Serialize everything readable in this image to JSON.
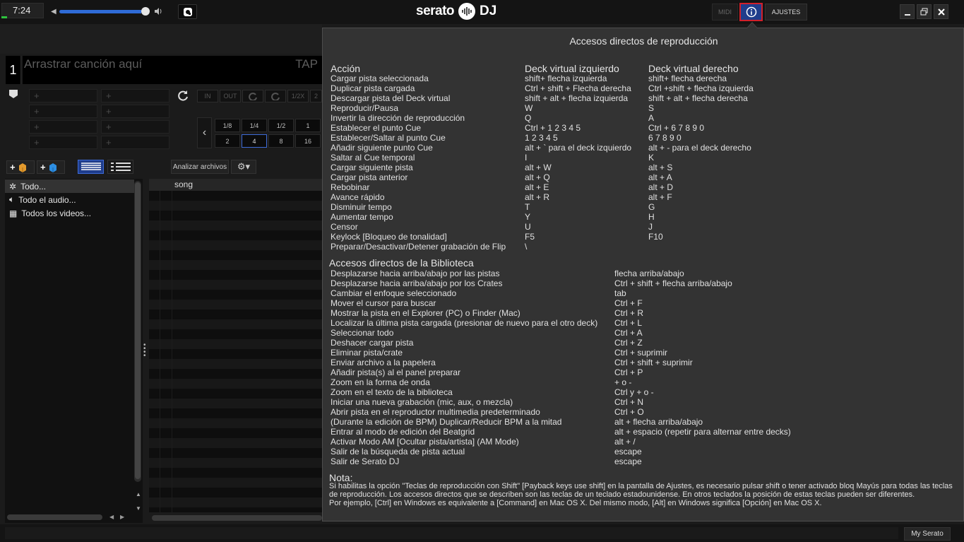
{
  "topbar": {
    "clock": "7:24",
    "volume_fraction": 0.95,
    "logo_text": "serato",
    "logo_dj": "DJ",
    "midi_label": "MIDI",
    "settings_label": "AJUSTES"
  },
  "deck": {
    "number": "1",
    "drop_label": "Arrastrar canción aquí",
    "tap_label": "TAP",
    "cue_slot_label": "+",
    "loop_buttons": [
      "IN",
      "OUT",
      "",
      "",
      "1/2X",
      "2"
    ],
    "loop_sizes": [
      "1/8",
      "1/4",
      "1/2",
      "1",
      "2",
      "4",
      "8",
      "16"
    ],
    "active_loop_size": "4"
  },
  "library": {
    "analyze_label": "Analizar archivos",
    "crates": [
      "Todo...",
      "Todo el audio...",
      "Todos los videos..."
    ],
    "column_header": "song"
  },
  "bottombar": {
    "myserato_label": "My Serato"
  },
  "shortcuts": {
    "title": "Accesos directos de reproducción",
    "playback_headers": [
      "Acción",
      "Deck virtual izquierdo",
      "Deck virtual derecho"
    ],
    "playback_rows": [
      [
        "Cargar pista seleccionada",
        "shift+ flecha izquierda",
        "shift+ flecha derecha"
      ],
      [
        "Duplicar pista cargada",
        "Ctrl + shift + Flecha derecha",
        "Ctrl +shift + flecha izquierda"
      ],
      [
        "Descargar pista del Deck virtual",
        "shift + alt + flecha izquierda",
        "shift + alt + flecha derecha"
      ],
      [
        "Reproducir/Pausa",
        "W",
        "S"
      ],
      [
        "Invertir la dirección de reproducción",
        "Q",
        "A"
      ],
      [
        "Establecer el punto Cue",
        "Ctrl + 1 2 3 4 5",
        "Ctrl + 6 7 8 9 0"
      ],
      [
        "Establecer/Saltar al punto Cue",
        "1 2 3 4 5",
        "6 7 8 9 0"
      ],
      [
        "Añadir siguiente punto Cue",
        "alt + ` para el deck izquierdo",
        "alt + - para el deck derecho"
      ],
      [
        "Saltar al Cue temporal",
        "I",
        "K"
      ],
      [
        "Cargar siguiente pista",
        "alt + W",
        "alt + S"
      ],
      [
        "Cargar pista anterior",
        "alt + Q",
        "alt + A"
      ],
      [
        "Rebobinar",
        "alt + E",
        "alt + D"
      ],
      [
        "Avance rápido",
        "alt + R",
        "alt + F"
      ],
      [
        "Disminuir tempo",
        "T",
        "G"
      ],
      [
        "Aumentar tempo",
        "Y",
        "H"
      ],
      [
        "Censor",
        "U",
        "J"
      ],
      [
        "Keylock [Bloqueo de tonalidad]",
        "F5",
        "F10"
      ],
      [
        "Preparar/Desactivar/Detener grabación de Flip",
        "\\",
        ""
      ]
    ],
    "library_title": "Accesos directos de la Biblioteca",
    "library_rows": [
      [
        "Desplazarse hacia arriba/abajo por las pistas",
        "flecha arriba/abajo"
      ],
      [
        "Desplazarse hacia arriba/abajo por los Crates",
        "Ctrl + shift + flecha arriba/abajo"
      ],
      [
        "Cambiar el enfoque seleccionado",
        "tab"
      ],
      [
        "Mover el cursor para buscar",
        "Ctrl + F"
      ],
      [
        "Mostrar la pista en el Explorer (PC) o Finder (Mac)",
        "Ctrl + R"
      ],
      [
        "Localizar la última pista cargada (presionar de nuevo para el otro deck)",
        "Ctrl + L"
      ],
      [
        "Seleccionar todo",
        "Ctrl + A"
      ],
      [
        "Deshacer cargar pista",
        "Ctrl + Z"
      ],
      [
        "Eliminar pista/crate",
        "Ctrl + suprimir"
      ],
      [
        "Enviar archivo a la papelera",
        "Ctrl + shift + suprimir"
      ],
      [
        "Añadir pista(s) al el panel preparar",
        "Ctrl + P"
      ],
      [
        "Zoom en la forma de onda",
        "+ o -"
      ],
      [
        "Zoom en el texto de la biblioteca",
        "Ctrl y + o -"
      ],
      [
        "Iniciar una nueva grabación (mic, aux, o mezcla)",
        "Ctrl + N"
      ],
      [
        "Abrir pista en el reproductor multimedia predeterminado",
        "Ctrl + O"
      ],
      [
        "(Durante la edición de BPM) Duplicar/Reducir BPM a la mitad",
        "alt + flecha arriba/abajo"
      ],
      [
        "Entrar al modo de edición del Beatgrid",
        "alt + espacio (repetir para alternar entre decks)"
      ],
      [
        "Activar Modo AM [Ocultar pista/artista] (AM Mode)",
        "alt + /"
      ],
      [
        "Salir de la búsqueda de pista actual",
        "escape"
      ],
      [
        "Salir de Serato DJ",
        "escape"
      ]
    ],
    "note_title": "Nota:",
    "note_p1": "Si habilitas la opción \"Teclas de reproducción con Shift\" [Payback keys use shift] en la pantalla de Ajustes, es necesario pulsar shift o tener activado bloq Mayús para todas las teclas de reproducción. Los accesos directos que se describen son las teclas de un teclado estadounidense. En otros teclados la posición de estas teclas pueden ser diferentes.",
    "note_p2": "Por ejemplo, [Ctrl] en Windows es equivalente a [Command] en Mac OS X. Del mismo modo, [Alt] en Windows significa [Opción] en Mac OS X."
  },
  "colors": {
    "accent_blue": "#2f6bd6",
    "info_border": "#d2202a",
    "overlay_bg": "#333333"
  }
}
